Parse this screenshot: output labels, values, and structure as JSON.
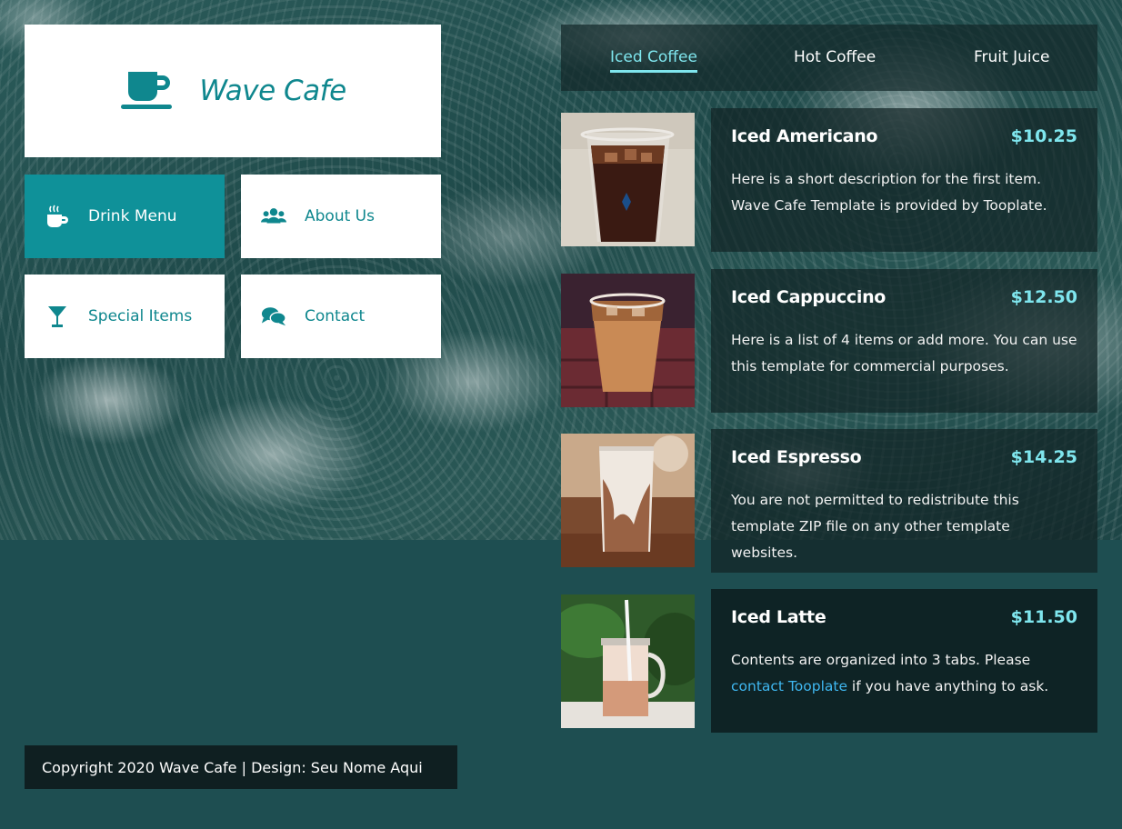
{
  "logo": {
    "name": "Wave Cafe",
    "icon": "coffee-cup-icon",
    "color": "#0f878e"
  },
  "nav": [
    {
      "label": "Drink Menu",
      "icon": "mug-hot-icon",
      "active": true
    },
    {
      "label": "About Us",
      "icon": "users-icon",
      "active": false
    },
    {
      "label": "Special Items",
      "icon": "cocktail-icon",
      "active": false
    },
    {
      "label": "Contact",
      "icon": "comments-icon",
      "active": false
    }
  ],
  "tabs": [
    {
      "label": "Iced Coffee",
      "active": true
    },
    {
      "label": "Hot Coffee",
      "active": false
    },
    {
      "label": "Fruit Juice",
      "active": false
    }
  ],
  "items": [
    {
      "name": "Iced Americano",
      "price": "$10.25",
      "desc_line1": "Here is a short description for the first item.",
      "desc_line2": "Wave Cafe Template is provided by Tooplate."
    },
    {
      "name": "Iced Cappuccino",
      "price": "$12.50",
      "desc_line1": "Here is a list of 4 items or add more. You can use",
      "desc_line2": "this template for commercial purposes."
    },
    {
      "name": "Iced Espresso",
      "price": "$14.25",
      "desc_line1": "You are not permitted to redistribute this",
      "desc_line2": "template ZIP file on any other template websites."
    },
    {
      "name": "Iced Latte",
      "price": "$11.50",
      "desc_line1": "Contents are organized into 3 tabs. Please",
      "desc_link": "contact Tooplate",
      "desc_line2_rest": " if you have anything to ask."
    }
  ],
  "footer": {
    "text": "Copyright 2020 Wave Cafe | Design: Seu Nome Aqui"
  },
  "colors": {
    "accent": "#0f9199",
    "price": "#7fe6ee",
    "link": "#3fb7f0",
    "page_bg": "#1e4e51"
  }
}
